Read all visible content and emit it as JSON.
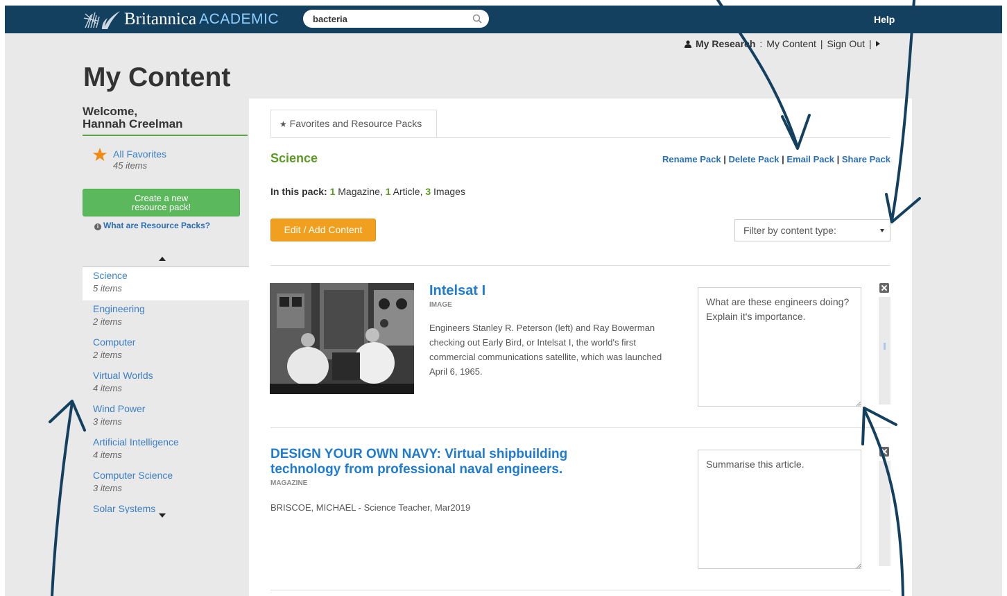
{
  "topbar": {
    "logo_text": "Britannica",
    "logo_sub": "ACADEMIC",
    "search_value": "bacteria",
    "help": "Help"
  },
  "account": {
    "my_research": "My Research",
    "colon": ":",
    "my_content": "My Content",
    "sign_out": "Sign Out",
    "sep1": "|",
    "sep2": "|"
  },
  "page_title": "My Content",
  "sidebar": {
    "welcome_line1": "Welcome,",
    "welcome_line2": "Hannah Creelman",
    "all_favorites": "All Favorites",
    "all_favorites_count": "45 items",
    "create_line1": "Create a new",
    "create_line2": "resource pack!",
    "what_are": "What are Resource Packs?",
    "packs": [
      {
        "name": "Science",
        "count": "5 items"
      },
      {
        "name": "Engineering",
        "count": "2 items"
      },
      {
        "name": "Computer",
        "count": "2 items"
      },
      {
        "name": "Virtual Worlds",
        "count": "4 items"
      },
      {
        "name": "Wind Power",
        "count": "3 items"
      },
      {
        "name": "Artificial Intelligence",
        "count": "4 items"
      },
      {
        "name": "Computer Science",
        "count": "3 items"
      },
      {
        "name": "Solar Systems",
        "count": ""
      }
    ]
  },
  "main": {
    "tab_label": "Favorites and Resource Packs",
    "pack_title": "Science",
    "actions": {
      "rename": "Rename Pack",
      "delete": "Delete Pack",
      "email": "Email Pack",
      "share": "Share Pack",
      "sep": "|"
    },
    "summary": {
      "label": "In this pack:",
      "mag_count": "1",
      "mag_label": "Magazine,",
      "art_count": "1",
      "art_label": "Article,",
      "img_count": "3",
      "img_label": "Images"
    },
    "edit_button": "Edit / Add Content",
    "filter_label": "Filter by content type:",
    "items": [
      {
        "title": "Intelsat I",
        "type": "IMAGE",
        "description": "Engineers Stanley R. Peterson (left) and Ray Bowerman checking out Early Bird, or Intelsat I, the world's first commercial communications satellite, which was launched April 6, 1965.",
        "note": "What are these engineers doing? Explain it's importance."
      },
      {
        "title_line1": "DESIGN YOUR OWN NAVY: Virtual shipbuilding",
        "title_line2": "technology from professional naval engineers.",
        "type": "MAGAZINE",
        "meta": "BRISCOE, MICHAEL - Science Teacher, Mar2019",
        "note": "Summarise this article."
      }
    ]
  },
  "colors": {
    "topbar": "#14405f",
    "link": "#3b7fc4",
    "green": "#5a9a23",
    "button_green": "#5cb85c",
    "button_orange": "#f0a01e",
    "title_blue": "#1f7bd0",
    "annotation": "#14405f"
  },
  "icons": [
    "britannica-thistle-icon",
    "search-icon",
    "user-icon",
    "caret-right-icon",
    "star-icon",
    "info-icon",
    "close-icon",
    "caret-up-icon",
    "caret-down-icon"
  ]
}
